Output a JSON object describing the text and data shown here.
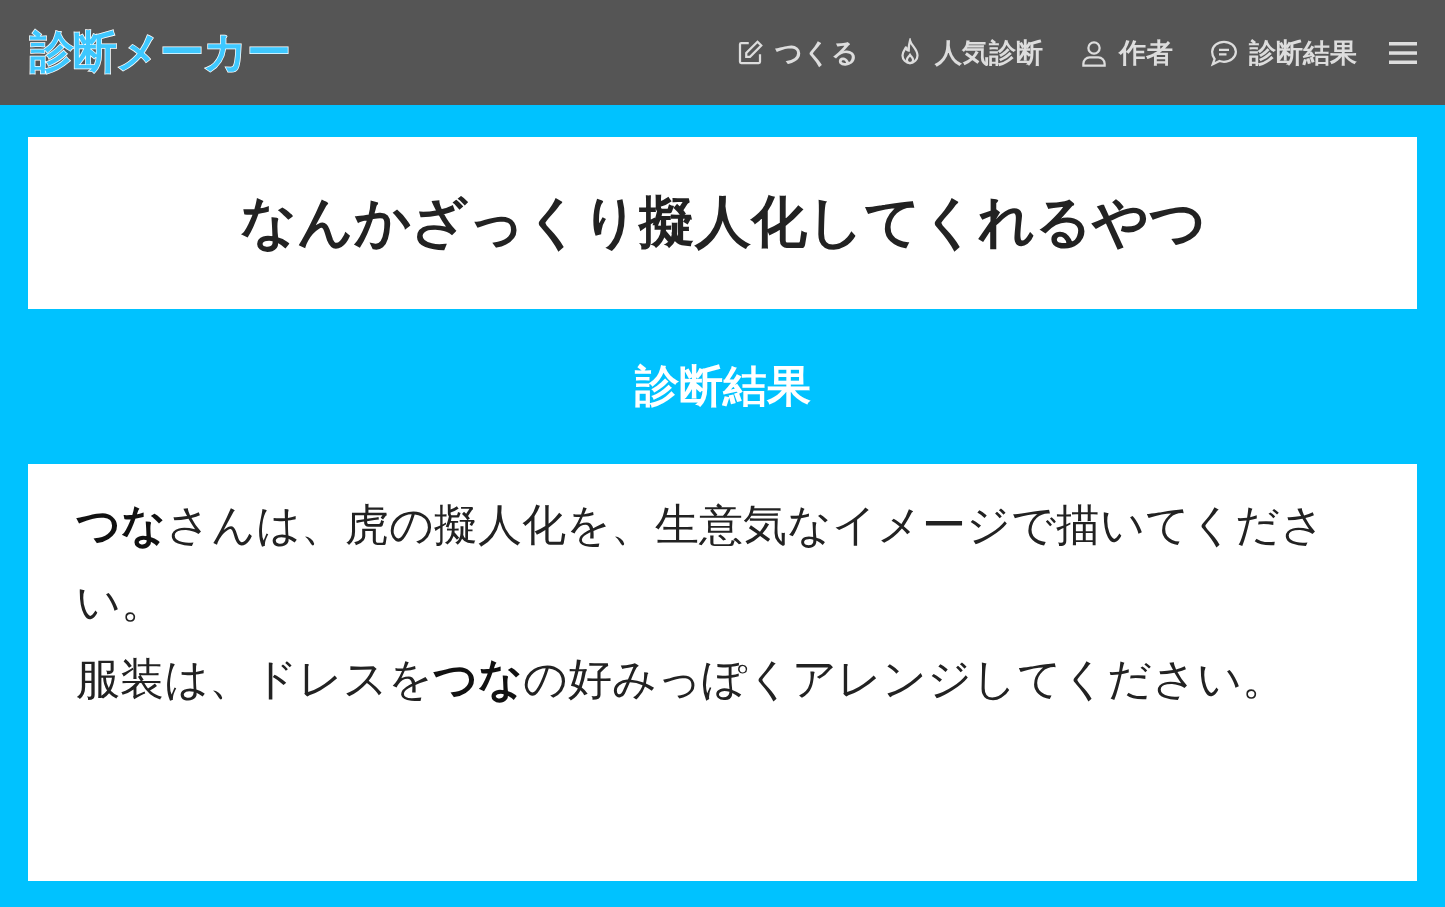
{
  "header": {
    "logo": "診断メーカー",
    "nav": [
      {
        "kind": "create",
        "label": "つくる"
      },
      {
        "kind": "popular",
        "label": "人気診断"
      },
      {
        "kind": "author",
        "label": "作者"
      },
      {
        "kind": "results",
        "label": "診断結果"
      }
    ]
  },
  "title": "なんかざっくり擬人化してくれるやつ",
  "section_heading": "診断結果",
  "result": [
    "**つな**さんは、虎の擬人化を、生意気なイメージで描いてください。",
    "服装は、ドレスを**つな**の好みっぽくアレンジしてください。"
  ]
}
